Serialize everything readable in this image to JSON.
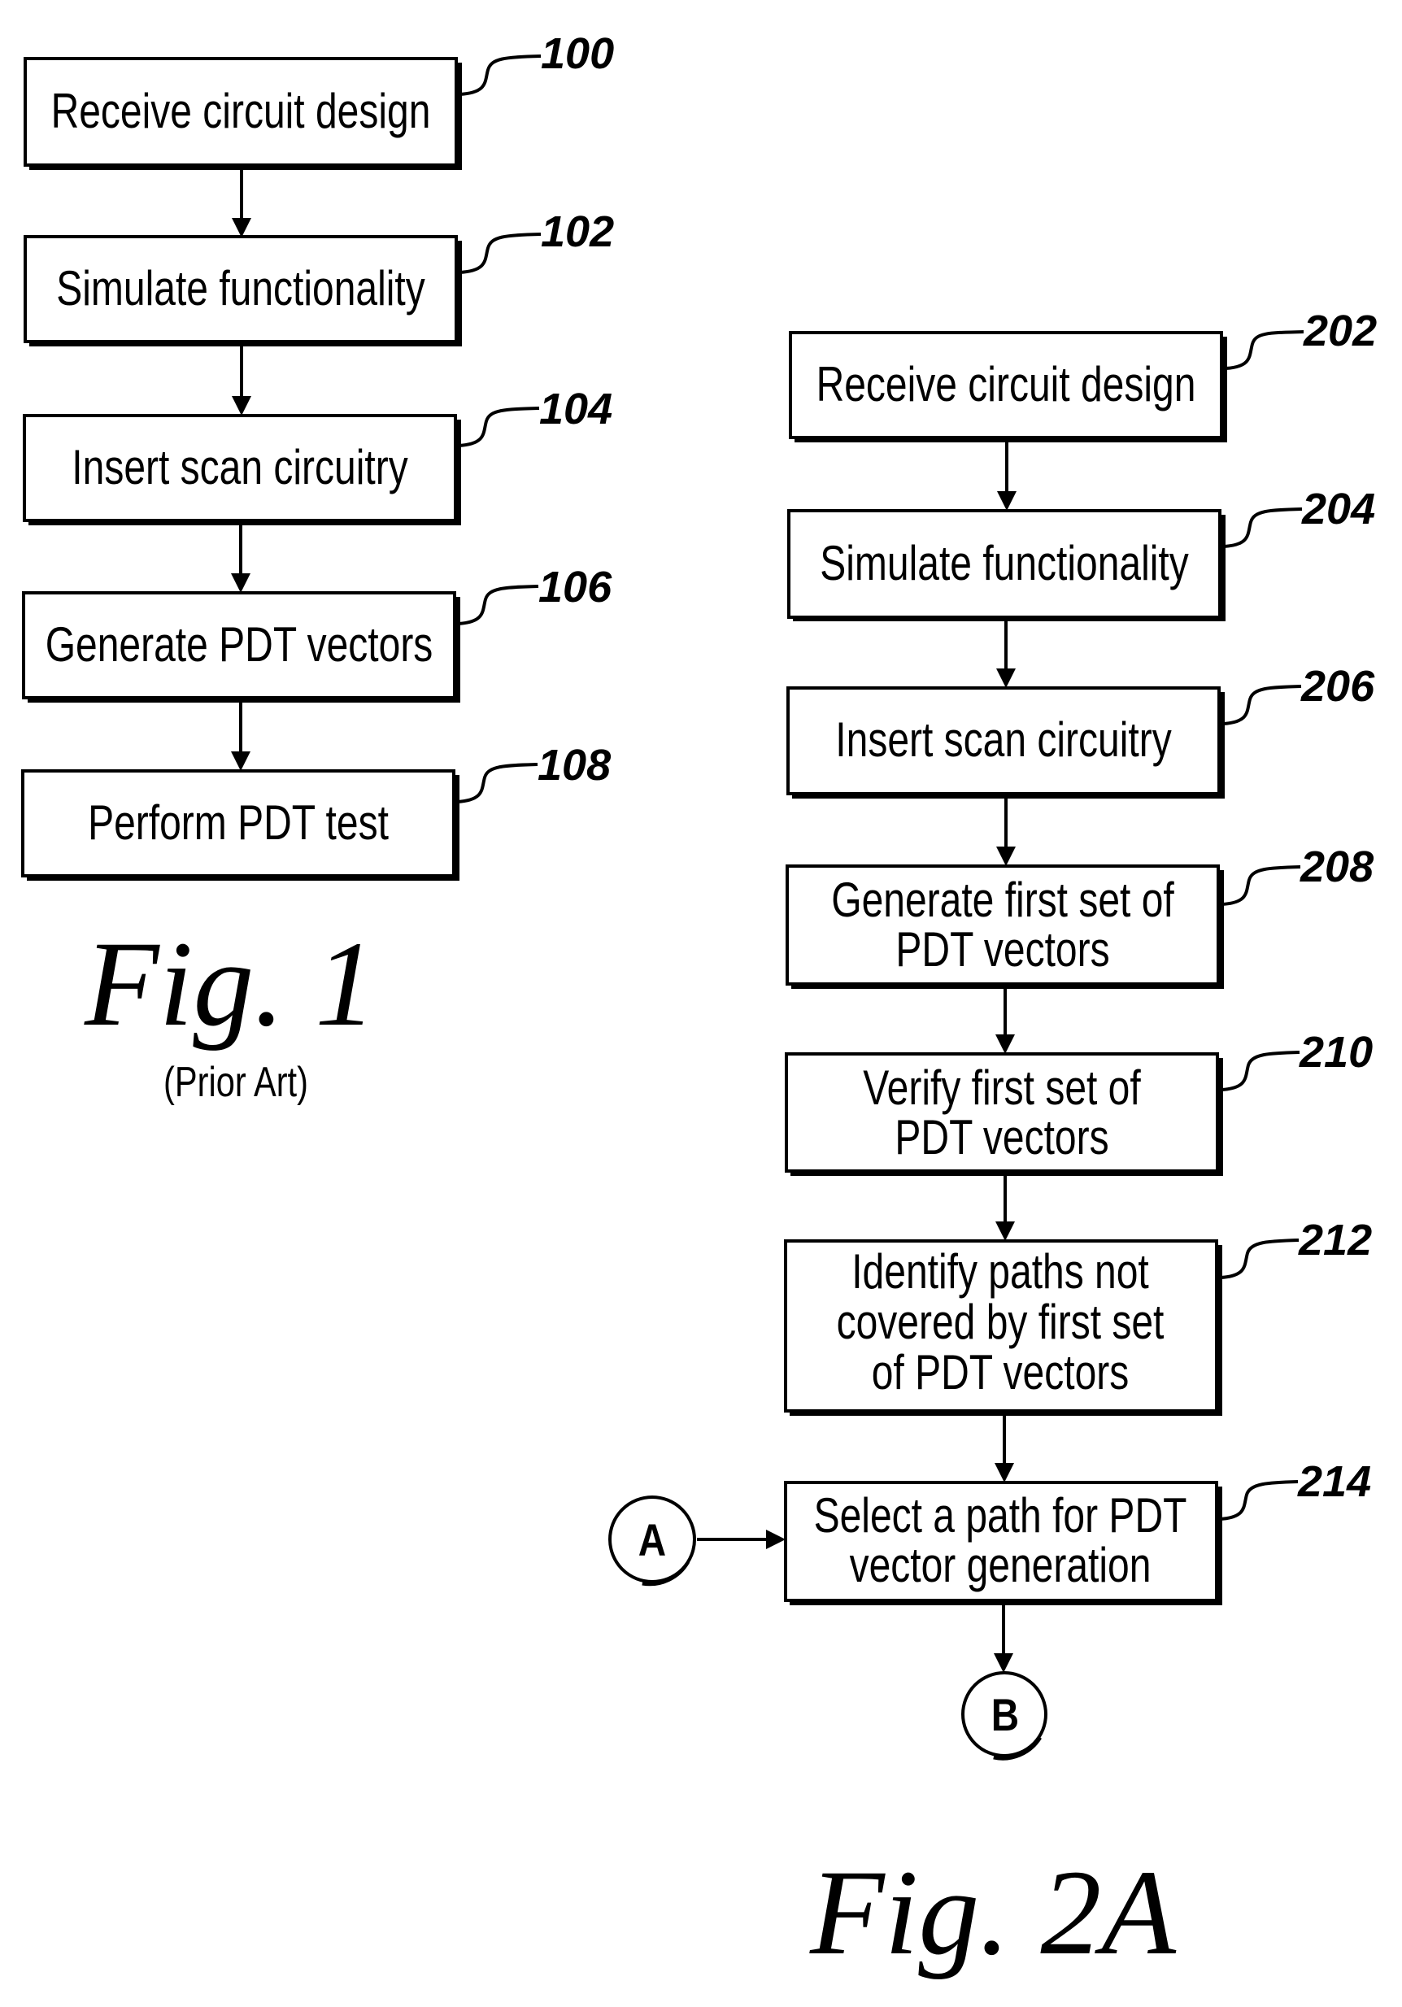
{
  "figure1": {
    "caption": "Fig. 1",
    "subcaption": "(Prior Art)",
    "steps": [
      {
        "ref": "100",
        "lines": [
          "Receive circuit design"
        ]
      },
      {
        "ref": "102",
        "lines": [
          "Simulate functionality"
        ]
      },
      {
        "ref": "104",
        "lines": [
          "Insert scan circuitry"
        ]
      },
      {
        "ref": "106",
        "lines": [
          "Generate PDT vectors"
        ]
      },
      {
        "ref": "108",
        "lines": [
          "Perform PDT test"
        ]
      }
    ]
  },
  "figure2a": {
    "caption": "Fig. 2A",
    "steps": [
      {
        "ref": "202",
        "lines": [
          "Receive circuit design"
        ]
      },
      {
        "ref": "204",
        "lines": [
          "Simulate functionality"
        ]
      },
      {
        "ref": "206",
        "lines": [
          "Insert scan circuitry"
        ]
      },
      {
        "ref": "208",
        "lines": [
          "Generate first set of",
          "PDT vectors"
        ]
      },
      {
        "ref": "210",
        "lines": [
          "Verify first set of",
          "PDT vectors"
        ]
      },
      {
        "ref": "212",
        "lines": [
          "Identify paths not",
          "covered by first set",
          "of PDT vectors"
        ]
      },
      {
        "ref": "214",
        "lines": [
          "Select a path for PDT",
          "vector generation"
        ]
      }
    ],
    "connectors": {
      "entry": "A",
      "exit": "B"
    }
  }
}
